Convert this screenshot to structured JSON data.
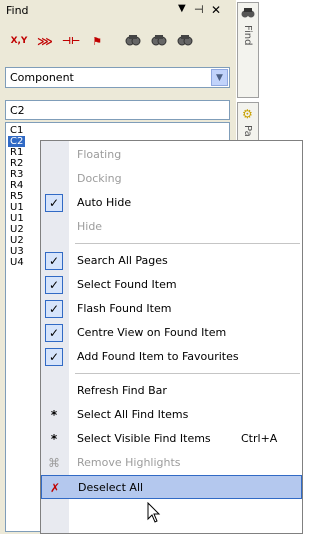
{
  "panel": {
    "title": "Find",
    "pin_glyph": "▾ ⊣ ✕",
    "tools": [
      {
        "name": "xy-icon",
        "text": "X,Y"
      },
      {
        "name": "net-icon",
        "text": "⋙"
      },
      {
        "name": "pad-icon",
        "text": "⊣⊢"
      },
      {
        "name": "flag-icon",
        "text": "⚑"
      },
      {
        "name": "find-icon",
        "text": "🔍"
      },
      {
        "name": "find-next-icon",
        "text": "🔍"
      },
      {
        "name": "find-prev-icon",
        "text": "🔍"
      }
    ],
    "combo_value": "Component",
    "search_value": "C2",
    "list": [
      "C1",
      "C2",
      "R1",
      "R2",
      "R3",
      "R4",
      "R5",
      "U1",
      "U1",
      "U2",
      "U2",
      "U3",
      "U4"
    ],
    "selected_index": 1
  },
  "tabstrip": {
    "tab1_label": "Find",
    "tab2_label": "Pa"
  },
  "menu": {
    "items": [
      {
        "label": "Floating",
        "disabled": true,
        "checked": false,
        "icon": "",
        "shortcut": ""
      },
      {
        "label": "Docking",
        "disabled": true,
        "checked": false,
        "icon": "",
        "shortcut": ""
      },
      {
        "label": "Auto Hide",
        "disabled": false,
        "checked": true,
        "icon": "✓",
        "shortcut": ""
      },
      {
        "label": "Hide",
        "disabled": true,
        "checked": false,
        "icon": "",
        "shortcut": ""
      },
      {
        "label": "Search All Pages",
        "disabled": false,
        "checked": true,
        "icon": "✓",
        "shortcut": ""
      },
      {
        "label": "Select Found Item",
        "disabled": false,
        "checked": true,
        "icon": "✓",
        "shortcut": ""
      },
      {
        "label": "Flash Found Item",
        "disabled": false,
        "checked": true,
        "icon": "✓",
        "shortcut": ""
      },
      {
        "label": "Centre View on Found Item",
        "disabled": false,
        "checked": true,
        "icon": "✓",
        "shortcut": ""
      },
      {
        "label": "Add Found Item to Favourites",
        "disabled": false,
        "checked": true,
        "icon": "✓",
        "shortcut": ""
      },
      {
        "label": "Refresh Find Bar",
        "disabled": false,
        "checked": false,
        "icon": "",
        "shortcut": ""
      },
      {
        "label": "Select All Find Items",
        "disabled": false,
        "checked": false,
        "icon": "*",
        "shortcut": ""
      },
      {
        "label": "Select Visible Find Items",
        "disabled": false,
        "checked": false,
        "icon": "*",
        "shortcut": "Ctrl+A"
      },
      {
        "label": "Remove Highlights",
        "disabled": true,
        "checked": false,
        "icon": "⌘",
        "shortcut": ""
      },
      {
        "label": "Deselect All",
        "disabled": false,
        "checked": false,
        "icon": "✗",
        "shortcut": ""
      }
    ]
  }
}
